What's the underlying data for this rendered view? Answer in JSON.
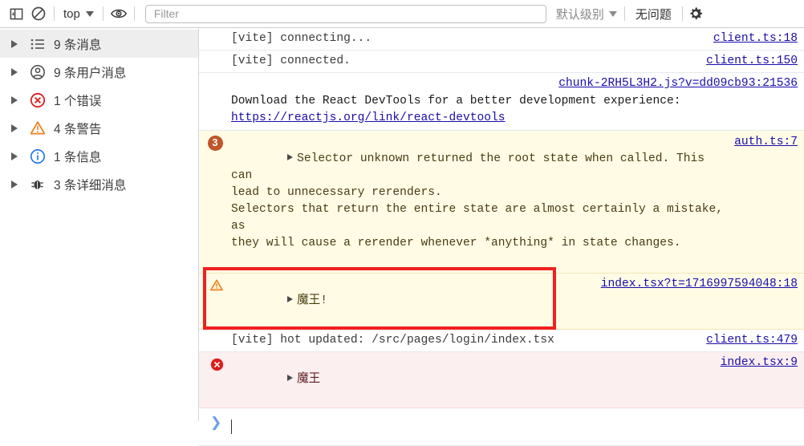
{
  "toolbar": {
    "sidebar_toggle_icon": "panel-toggle-icon",
    "clear_console_icon": "clear-console-icon",
    "context_label": "top",
    "eye_icon": "eye-icon",
    "filter_placeholder": "Filter",
    "filter_value": "",
    "levels_label": "默认级别",
    "issues_label": "无问题",
    "settings_icon": "gear-icon"
  },
  "sidebar": {
    "items": [
      {
        "label": "9 条消息",
        "icon": "list-icon",
        "selected": true
      },
      {
        "label": "9 条用户消息",
        "icon": "user-icon",
        "selected": false
      },
      {
        "label": "1 个错误",
        "icon": "error-icon",
        "selected": false
      },
      {
        "label": "4 条警告",
        "icon": "warning-icon",
        "selected": false
      },
      {
        "label": "1 条信息",
        "icon": "info-icon",
        "selected": false
      },
      {
        "label": "3 条详细消息",
        "icon": "bug-icon",
        "selected": false
      }
    ]
  },
  "console": {
    "rows": [
      {
        "id": "vite-connecting",
        "type": "log",
        "text": "[vite] connecting...",
        "link": "client.ts:18"
      },
      {
        "id": "vite-connected",
        "type": "log",
        "text": "[vite] connected.",
        "link": "client.ts:150"
      },
      {
        "id": "react-devtools",
        "type": "log",
        "text": "Download the React DevTools for a better development experience:",
        "inline_link": "https://reactjs.org/link/react-devtools",
        "link": "chunk-2RH5L3H2.js?v=dd09cb93:21536"
      },
      {
        "id": "selector-warning",
        "type": "warning",
        "badge": "3",
        "text": "Selector unknown returned the root state when called. This can\nlead to unnecessary rerenders.\nSelectors that return the entire state are almost certainly a mistake, as\nthey will cause a rerender whenever *anything* in state changes.",
        "link": "auth.ts:7"
      },
      {
        "id": "mowang-warning",
        "type": "warning",
        "text": "魔王!",
        "link": "index.tsx?t=1716997594048:18"
      },
      {
        "id": "vite-hot-updated",
        "type": "log",
        "text": "[vite] hot updated: /src/pages/login/index.tsx",
        "link": "client.ts:479"
      },
      {
        "id": "mowang-error",
        "type": "error",
        "text": "魔王",
        "link": "index.tsx:9"
      }
    ],
    "prompt": {
      "chevron": "❯",
      "value": ""
    }
  },
  "annotation": {
    "type": "rectangle",
    "color": "#f02020"
  }
}
